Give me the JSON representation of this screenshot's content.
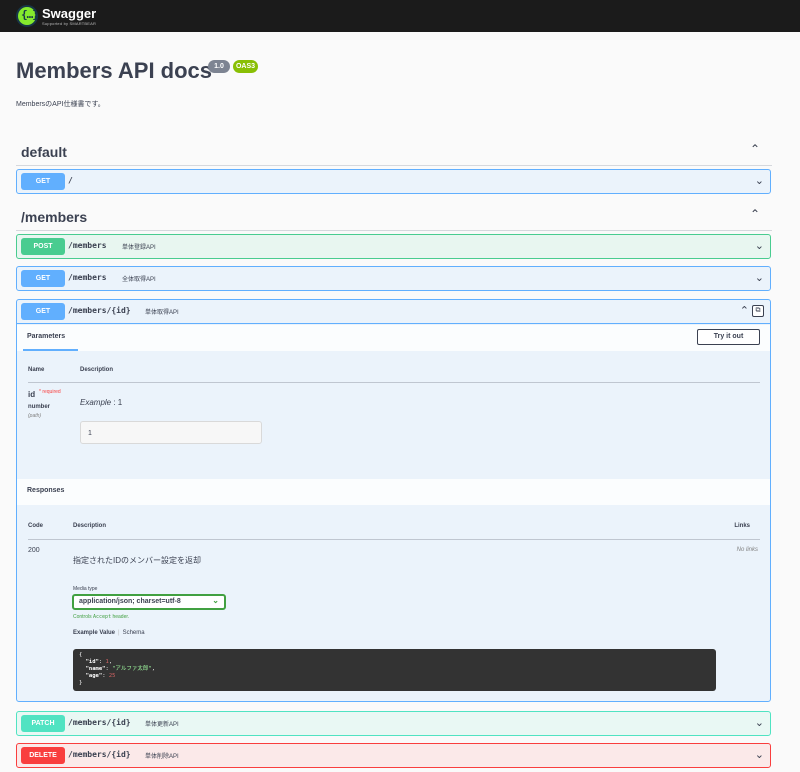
{
  "topbar": {
    "brand": "Swagger",
    "brand_sub": "Supported by SMARTBEAR",
    "logo_glyph": "{…}"
  },
  "info": {
    "title": "Members API docs",
    "version": "1.0",
    "oas": "OAS3",
    "description": "MembersのAPI仕様書です。"
  },
  "tags": [
    {
      "name": "default"
    },
    {
      "name": "/members"
    }
  ],
  "chevrons": {
    "up": "⌃",
    "down": "⌄"
  },
  "operations": [
    {
      "method": "GET",
      "path": "/",
      "summary": ""
    },
    {
      "method": "POST",
      "path": "/members",
      "summary": "単体登録API"
    },
    {
      "method": "GET",
      "path": "/members",
      "summary": "全体取得API"
    },
    {
      "method": "GET",
      "path": "/members/{id}",
      "summary": "単体取得API"
    },
    {
      "method": "PATCH",
      "path": "/members/{id}",
      "summary": "単体更新API"
    },
    {
      "method": "DELETE",
      "path": "/members/{id}",
      "summary": "単体削除API"
    }
  ],
  "expanded": {
    "parameters_title": "Parameters",
    "try_it_out": "Try it out",
    "col_name": "Name",
    "col_description": "Description",
    "param": {
      "name": "id",
      "required_mark": "* required",
      "type": "number",
      "location": "(path)",
      "example_label": "Example",
      "example_sep": " : ",
      "example_value": "1",
      "input_value": "1"
    },
    "responses_title": "Responses",
    "col_code": "Code",
    "col_resp_description": "Description",
    "col_links": "Links",
    "response": {
      "code": "200",
      "description": "指定されたIDのメンバー設定を返却",
      "links": "No links",
      "media_type_label": "Media type",
      "media_type": "application/json; charset=utf-8",
      "controls_prefix": "Controls ",
      "controls_code": "Accept",
      "controls_suffix": " header.",
      "example_value_tab": "Example Value",
      "tab_sep": "|",
      "schema_tab": "Schema",
      "example": {
        "open": "{",
        "id_key": "\"id\"",
        "id_val": "1",
        "name_key": "\"name\"",
        "name_val": "\"アルファ太郎\"",
        "age_key": "\"age\"",
        "age_val": "25",
        "close": "}"
      }
    }
  },
  "colors": {
    "get": "#61affe",
    "post": "#49cc90",
    "patch": "#50e3c2",
    "delete": "#f93e3e",
    "topbar": "#1b1b1b"
  }
}
